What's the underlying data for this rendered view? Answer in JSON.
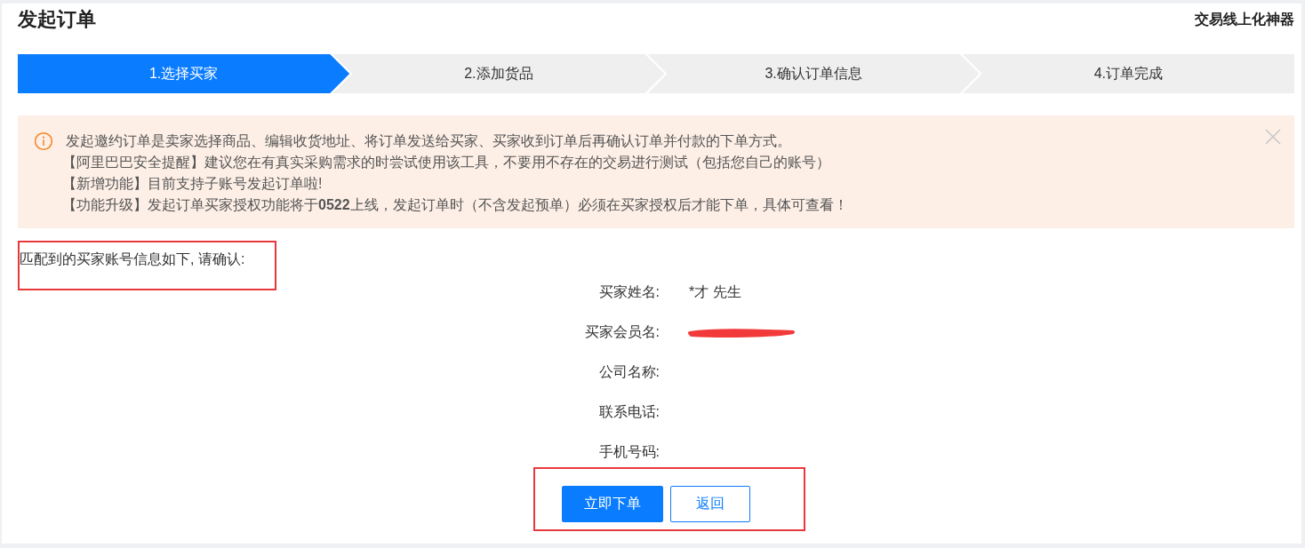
{
  "page": {
    "title": "发起订单",
    "tagline": "交易线上化神器"
  },
  "steps": [
    {
      "label": "1.选择买家",
      "selected": true
    },
    {
      "label": "2.添加货品",
      "selected": false
    },
    {
      "label": "3.确认订单信息",
      "selected": false
    },
    {
      "label": "4.订单完成",
      "selected": false
    }
  ],
  "notice": {
    "lines": [
      "发起邀约订单是卖家选择商品、编辑收货地址、将订单发送给买家、买家收到订单后再确认订单并付款的下单方式。",
      "【阿里巴巴安全提醒】建议您在有真实采购需求的时尝试使用该工具，不要用不存在的交易进行测试（包括您自己的账号）",
      "【新增功能】目前支持子账号发起订单啦!",
      "【功能升级】发起订单买家授权功能将于**0522**上线，发起订单时（不含发起预单）必须在买家授权后才能下单，具体可查看！"
    ]
  },
  "prompt": "匹配到的买家账号信息如下, 请确认:",
  "fields": [
    {
      "label": "买家姓名:",
      "kind": "text",
      "value": "*才 先生"
    },
    {
      "label": "买家会员名:",
      "kind": "redacted"
    },
    {
      "label": "公司名称:",
      "kind": "empty"
    },
    {
      "label": "联系电话:",
      "kind": "empty"
    },
    {
      "label": "手机号码:",
      "kind": "empty"
    }
  ],
  "buttons": [
    {
      "label": "立即下单",
      "kind": "primary"
    },
    {
      "label": "返回",
      "kind": "secondary"
    }
  ]
}
